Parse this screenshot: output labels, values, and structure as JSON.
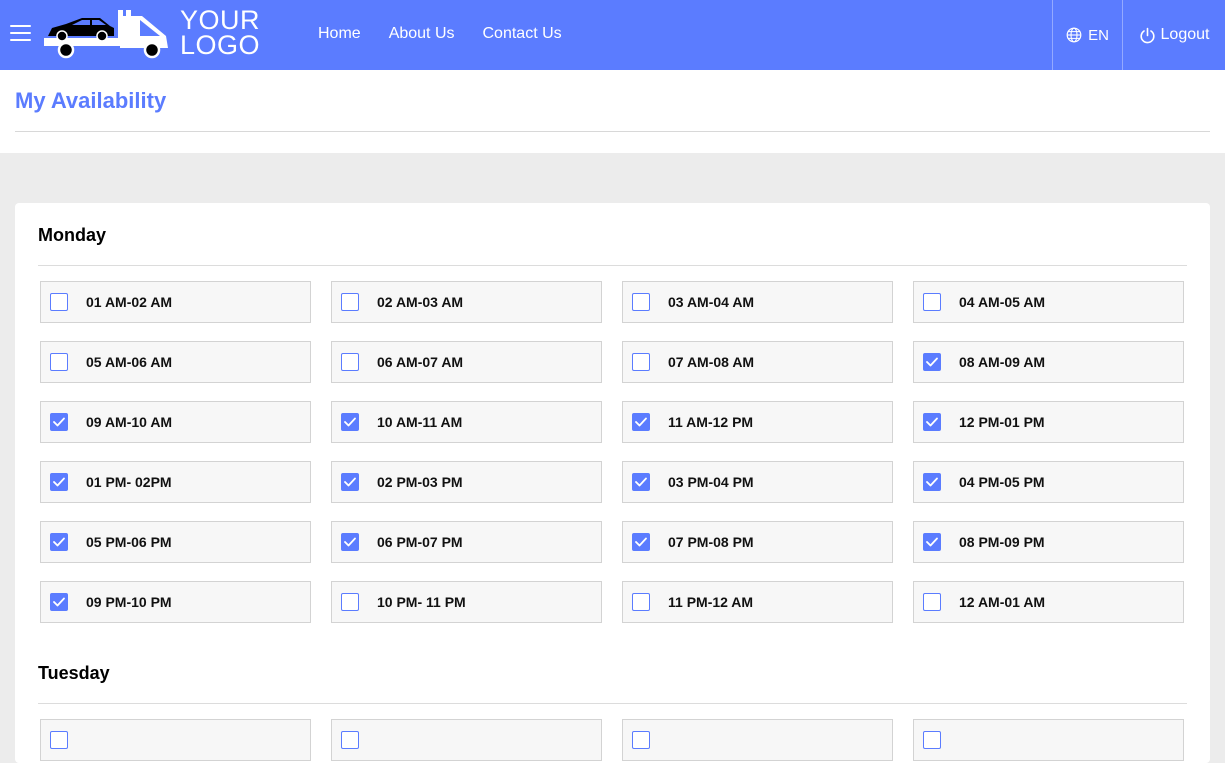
{
  "header": {
    "logo_line1": "YOUR",
    "logo_line2": "LOGO",
    "nav": [
      "Home",
      "About Us",
      "Contact Us"
    ],
    "language": "EN",
    "logout": "Logout",
    "accent_color": "#5b7cff"
  },
  "page": {
    "title": "My Availability"
  },
  "days": [
    {
      "name": "Monday",
      "slots": [
        {
          "label": "01 AM-02 AM",
          "checked": false
        },
        {
          "label": "02 AM-03 AM",
          "checked": false
        },
        {
          "label": "03 AM-04 AM",
          "checked": false
        },
        {
          "label": "04 AM-05 AM",
          "checked": false
        },
        {
          "label": "05 AM-06 AM",
          "checked": false
        },
        {
          "label": "06 AM-07 AM",
          "checked": false
        },
        {
          "label": "07 AM-08 AM",
          "checked": false
        },
        {
          "label": "08 AM-09 AM",
          "checked": true
        },
        {
          "label": "09 AM-10 AM",
          "checked": true
        },
        {
          "label": "10 AM-11 AM",
          "checked": true
        },
        {
          "label": "11 AM-12 PM",
          "checked": true
        },
        {
          "label": "12 PM-01 PM",
          "checked": true
        },
        {
          "label": "01 PM- 02PM",
          "checked": true
        },
        {
          "label": "02 PM-03 PM",
          "checked": true
        },
        {
          "label": "03 PM-04 PM",
          "checked": true
        },
        {
          "label": "04 PM-05 PM",
          "checked": true
        },
        {
          "label": "05 PM-06 PM",
          "checked": true
        },
        {
          "label": "06 PM-07 PM",
          "checked": true
        },
        {
          "label": "07 PM-08 PM",
          "checked": true
        },
        {
          "label": "08 PM-09 PM",
          "checked": true
        },
        {
          "label": "09 PM-10 PM",
          "checked": true
        },
        {
          "label": "10 PM- 11 PM",
          "checked": false
        },
        {
          "label": "11 PM-12 AM",
          "checked": false
        },
        {
          "label": "12 AM-01 AM",
          "checked": false
        }
      ]
    },
    {
      "name": "Tuesday",
      "slots": [
        {
          "label": "",
          "checked": false
        },
        {
          "label": "",
          "checked": false
        },
        {
          "label": "",
          "checked": false
        },
        {
          "label": "",
          "checked": false
        }
      ]
    }
  ]
}
